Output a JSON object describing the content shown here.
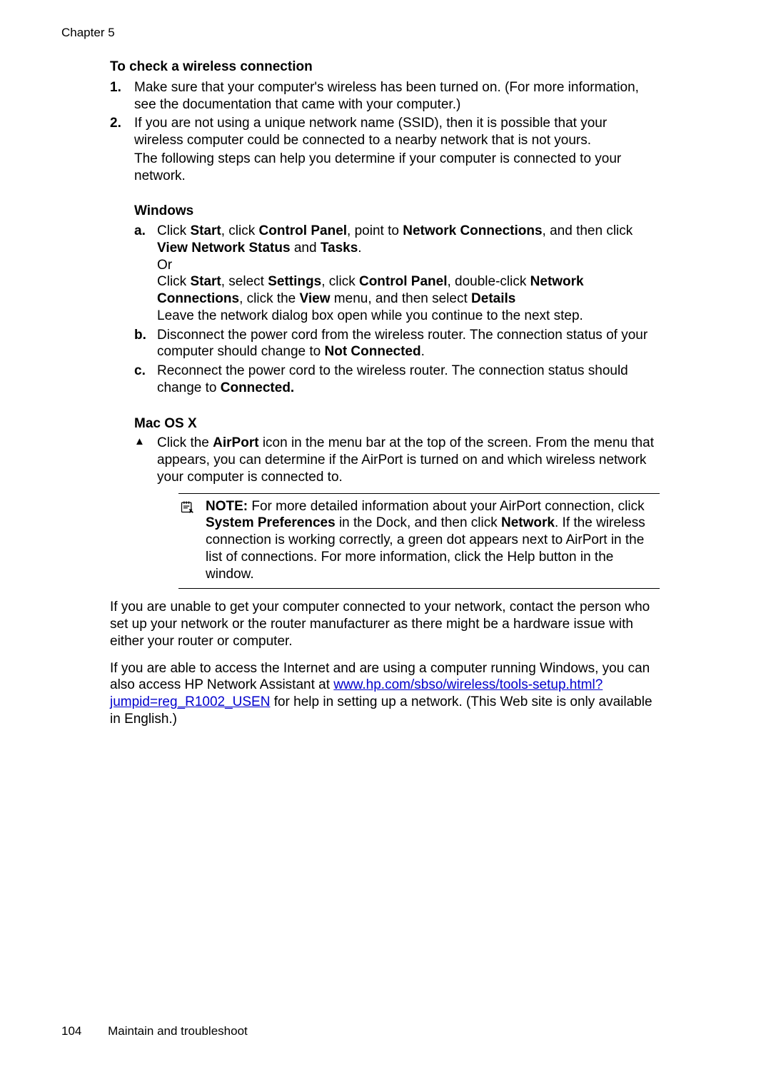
{
  "chapter_header": "Chapter 5",
  "heading_main": "To check a wireless connection",
  "step1": "Make sure that your computer's wireless has been turned on. (For more information, see the documentation that came with your computer.)",
  "step2_p1": "If you are not using a unique network name (SSID), then it is possible that your wireless computer could be connected to a nearby network that is not yours.",
  "step2_p2": "The following steps can help you determine if your computer is connected to your network.",
  "windows_heading": "Windows",
  "win_a_pre1": "Click ",
  "win_a_b1": "Start",
  "win_a_mid1": ", click ",
  "win_a_b2": "Control Panel",
  "win_a_mid2": ", point to ",
  "win_a_b3": "Network Connections",
  "win_a_mid3": ", and then click ",
  "win_a_b4": "View Network Status",
  "win_a_mid4": " and ",
  "win_a_b5": "Tasks",
  "win_a_end1": ".",
  "win_a_or": "Or",
  "win_a_pre2": "Click ",
  "win_a_b6": "Start",
  "win_a_mid5": ", select ",
  "win_a_b7": "Settings",
  "win_a_mid6": ", click ",
  "win_a_b8": "Control Panel",
  "win_a_mid7": ", double-click ",
  "win_a_b9": "Network Connections",
  "win_a_mid8": ", click the ",
  "win_a_b10": "View",
  "win_a_mid9": " menu, and then select ",
  "win_a_b11": "Details",
  "win_a_leave": "Leave the network dialog box open while you continue to the next step.",
  "win_b_pre": "Disconnect the power cord from the wireless router. The connection status of your computer should change to ",
  "win_b_bold": "Not Connected",
  "win_b_end": ".",
  "win_c_pre": "Reconnect the power cord to the wireless router. The connection status should change to ",
  "win_c_bold": "Connected.",
  "mac_heading": "Mac OS X",
  "mac_pre": "Click the ",
  "mac_b1": "AirPort",
  "mac_post": " icon in the menu bar at the top of the screen. From the menu that appears, you can determine if the AirPort is turned on and which wireless network your computer is connected to.",
  "note_label": "NOTE:",
  "note_t1": "  For more detailed information about your AirPort connection, click ",
  "note_b1": "System Preferences",
  "note_t2": " in the Dock, and then click ",
  "note_b2": "Network",
  "note_t3": ". If the wireless connection is working correctly, a green dot appears next to AirPort in the list of connections. For more information, click the Help button in the window.",
  "para1": "If you are unable to get your computer connected to your network, contact the person who set up your network or the router manufacturer as there might be a hardware issue with either your router or computer.",
  "para2_pre": "If you are able to access the Internet and are using a computer running Windows, you can also access HP Network Assistant at ",
  "link_text": "www.hp.com/sbso/wireless/tools-setup.html?jumpid=reg_R1002_USEN",
  "link_href": "http://www.hp.com/sbso/wireless/tools-setup.html?jumpid=reg_R1002_USEN",
  "para2_post": " for help in setting up a network. (This Web site is only available in English.)",
  "footer_page": "104",
  "footer_title": "Maintain and troubleshoot"
}
